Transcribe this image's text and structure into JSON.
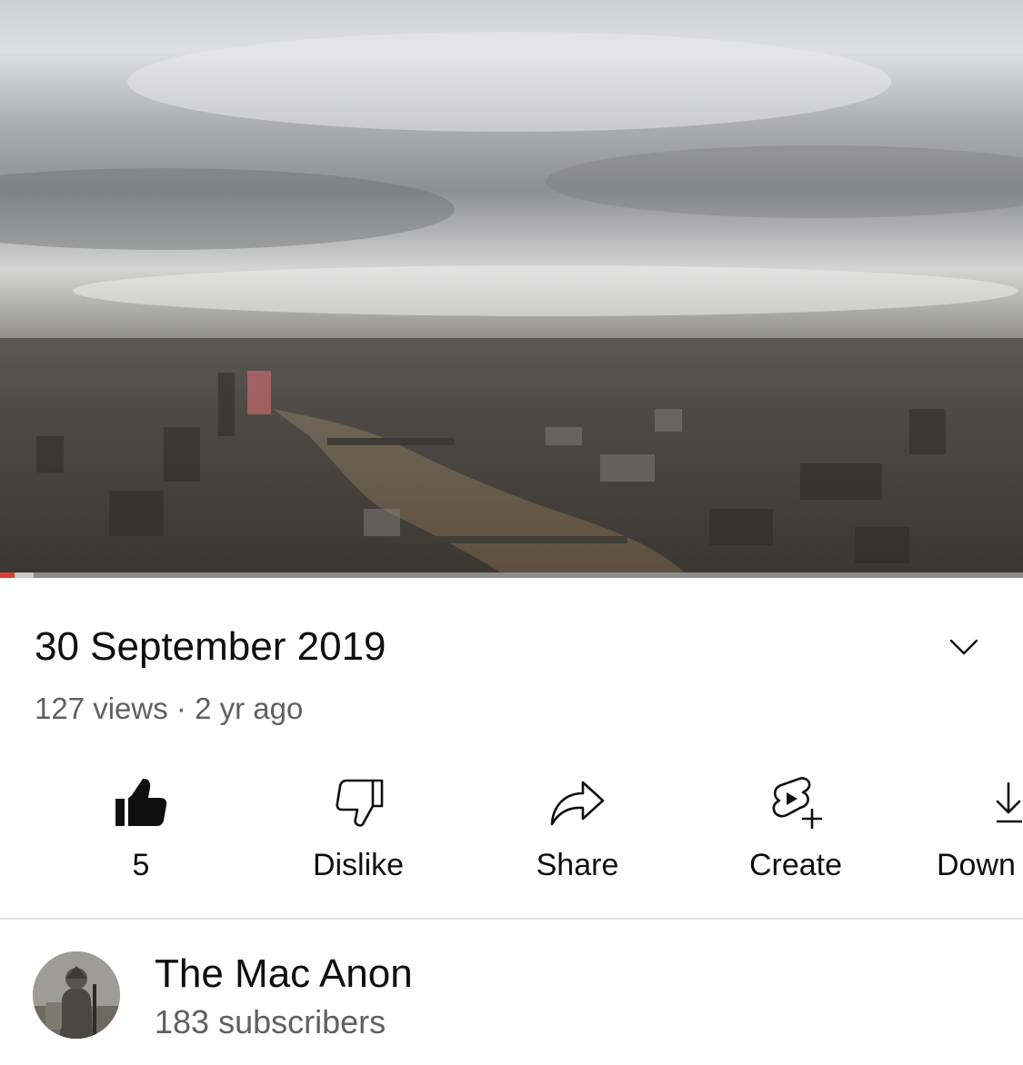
{
  "video": {
    "progress_played_fraction": 0.014,
    "progress_buffered_fraction": 0.033,
    "colors": {
      "played": "#e53935",
      "buffered": "#c9c9c9",
      "track": "#8d8c8c"
    }
  },
  "details": {
    "title": "30 September 2019",
    "meta": "127 views · 2 yr ago",
    "expand_icon": "chevron-down-icon"
  },
  "actions": [
    {
      "id": "like",
      "icon": "thumbs-up-filled-icon",
      "label": "5"
    },
    {
      "id": "dislike",
      "icon": "thumbs-down-outline-icon",
      "label": "Dislike"
    },
    {
      "id": "share",
      "icon": "share-arrow-icon",
      "label": "Share"
    },
    {
      "id": "create",
      "icon": "create-shorts-icon",
      "label": "Create"
    },
    {
      "id": "download",
      "icon": "download-icon",
      "label": "Down"
    }
  ],
  "channel": {
    "name": "The Mac Anon",
    "subscribers": "183 subscribers"
  }
}
